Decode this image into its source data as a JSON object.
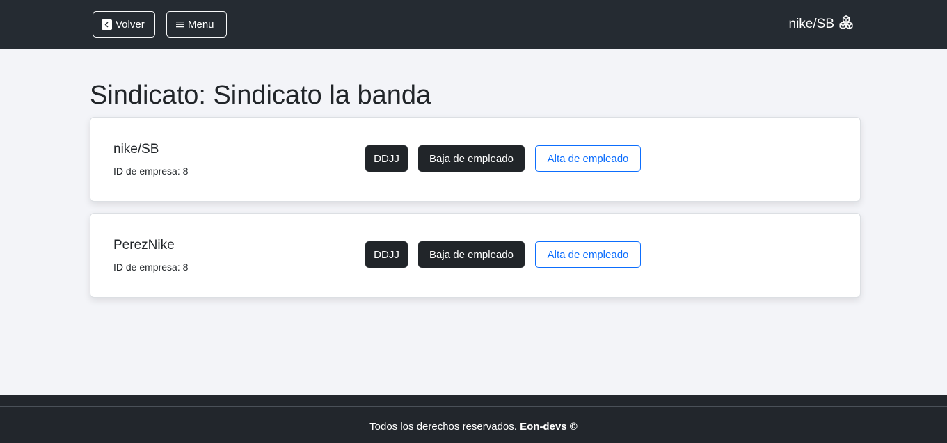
{
  "navbar": {
    "back_label": "Volver",
    "menu_label": "Menu",
    "brand_name": "nike/SB",
    "brand_icon": "boxes-icon",
    "back_icon": "arrow-left-square-icon",
    "menu_icon": "hamburger-menu-icon"
  },
  "page": {
    "title": "Sindicato: Sindicato la banda"
  },
  "companies": [
    {
      "name": "nike/SB",
      "id_text": "ID de empresa: 8",
      "ddjj_label": "DDJJ",
      "baja_label": "Baja de empleado",
      "alta_label": "Alta de empleado"
    },
    {
      "name": "PerezNike",
      "id_text": "ID de empresa: 8",
      "ddjj_label": "DDJJ",
      "baja_label": "Baja de empleado",
      "alta_label": "Alta de empleado"
    }
  ],
  "footer": {
    "text": "Todos los derechos reservados.",
    "brand": "Eon-devs ©"
  },
  "colors": {
    "navbar_bg": "#252b32",
    "page_bg": "#f3f4f8",
    "dark_button": "#212529",
    "primary_outline": "#0d6efd",
    "footer_bg": "#22262c"
  }
}
